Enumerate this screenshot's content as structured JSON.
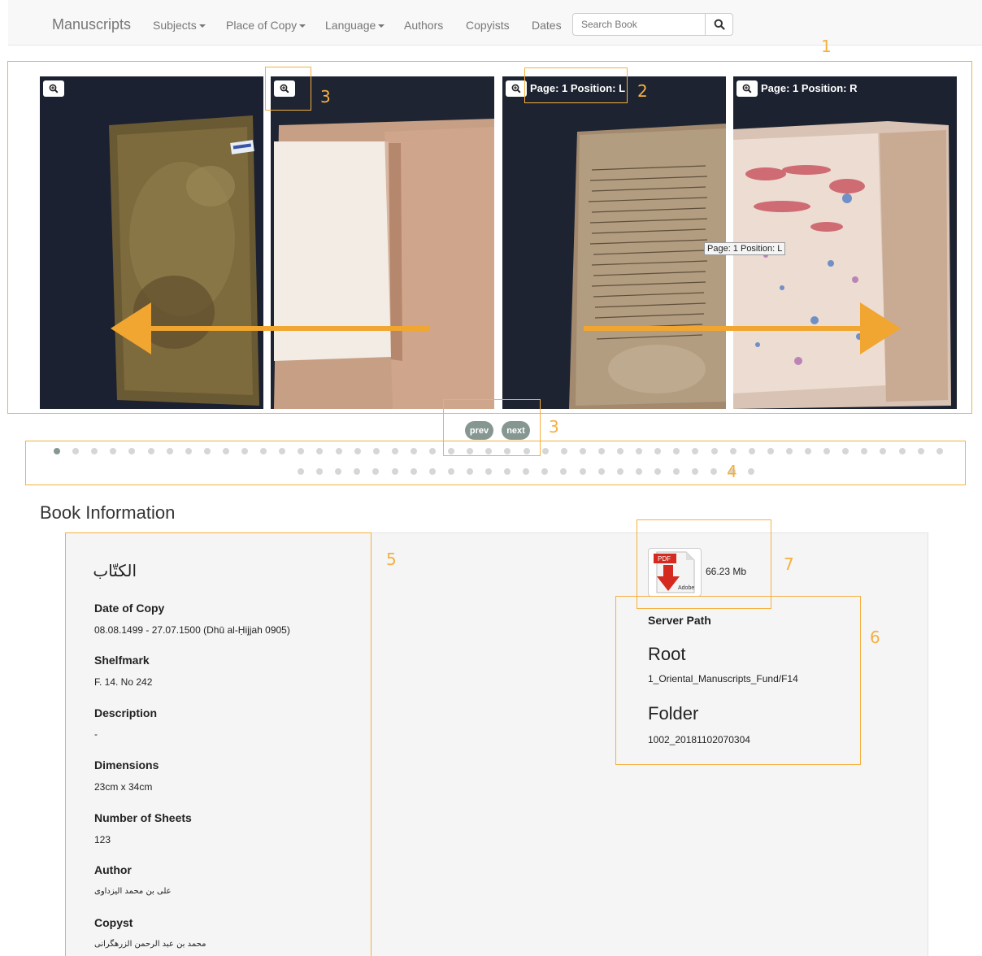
{
  "navbar": {
    "brand": "Manuscripts",
    "items": [
      {
        "label": "Subjects",
        "dropdown": true
      },
      {
        "label": "Place of Copy",
        "dropdown": true
      },
      {
        "label": "Language",
        "dropdown": true
      },
      {
        "label": "Authors",
        "dropdown": false
      },
      {
        "label": "Copyists",
        "dropdown": false
      },
      {
        "label": "Dates",
        "dropdown": false
      }
    ],
    "search_placeholder": "Search Book",
    "search_icon": "search-icon"
  },
  "carousel": {
    "panels": [
      {
        "page_label": "",
        "content": "front-cover"
      },
      {
        "page_label": "",
        "content": "inner-cover"
      },
      {
        "page_label": "Page: 1 Position: L",
        "content": "arabic-text-page"
      },
      {
        "page_label": "Page: 1 Position: R",
        "content": "ink-stained-page"
      }
    ],
    "tooltip": "Page: 1 Position: L",
    "prev_label": "prev",
    "next_label": "next",
    "dots_total": 73,
    "active_dot": 0
  },
  "annotations": [
    "1",
    "2",
    "3",
    "3",
    "4",
    "5",
    "6",
    "7"
  ],
  "book_info": {
    "heading": "Book Information",
    "title": "الكتّاب",
    "fields": [
      {
        "label": "Date of Copy",
        "value": "08.08.1499 - 27.07.1500 (Dhū al-Ḥijjah 0905)"
      },
      {
        "label": "Shelfmark",
        "value": "F. 14. No 242"
      },
      {
        "label": "Description",
        "value": "-"
      },
      {
        "label": "Dimensions",
        "value": "23cm x 34cm"
      },
      {
        "label": "Number of Sheets",
        "value": "123"
      },
      {
        "label": "Author",
        "value": "على بن محمد اليزداوى"
      },
      {
        "label": "Copyst",
        "value": "محمد بن عبد الرحمن الزرهگرانى"
      }
    ],
    "pdf": {
      "icon": "pdf-file-icon",
      "badge": "PDF",
      "brand": "Adobe",
      "size": "66.23 Mb"
    },
    "server_path": {
      "label": "Server Path",
      "root_heading": "Root",
      "root_value": "1_Oriental_Manuscripts_Fund/F14",
      "folder_heading": "Folder",
      "folder_value": "1002_20181102070304"
    }
  },
  "colors": {
    "annotation": "#f5b040",
    "button": "#869791",
    "panel_bg": "#1c2230"
  }
}
